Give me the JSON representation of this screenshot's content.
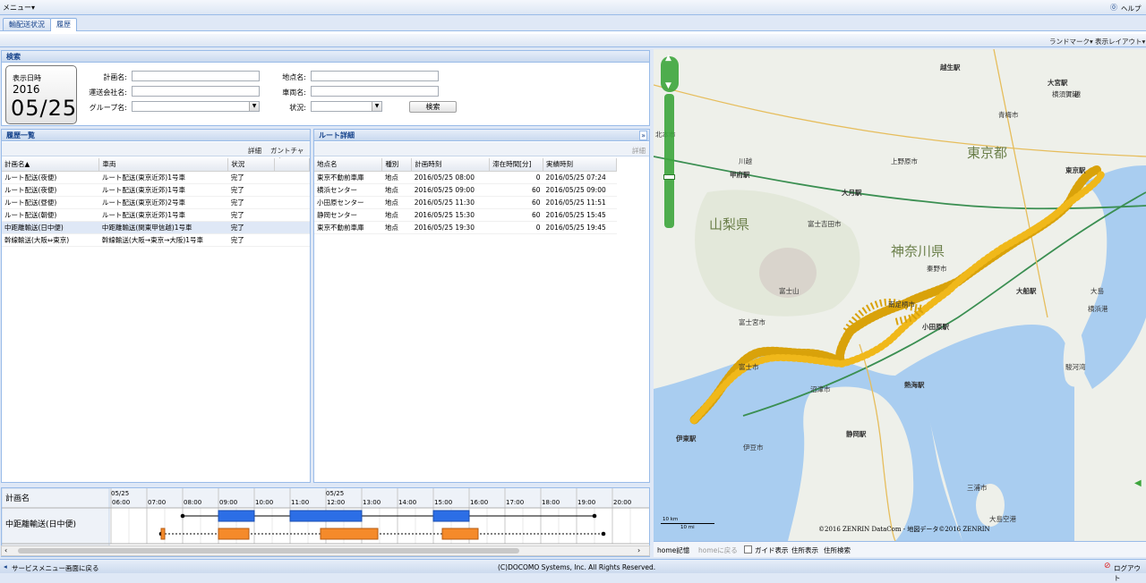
{
  "menu": {
    "label": "メニュー▾",
    "help": "ヘルプ"
  },
  "tabs": [
    {
      "label": "輸配送状況"
    },
    {
      "label": "履歴"
    }
  ],
  "toolbar": {
    "landmark": "ランドマーク▾",
    "layout": "表示レイアウト▾"
  },
  "search": {
    "title": "検索",
    "date_label": "表示日時",
    "year": "2016",
    "monthday": "05/25",
    "plan_name_label": "計画名:",
    "carrier_label": "運送会社名:",
    "group_label": "グループ名:",
    "place_label": "地点名:",
    "vehicle_label": "車両名:",
    "status_label": "状況:",
    "search_button": "検索"
  },
  "history": {
    "title": "履歴一覧",
    "detail_btn": "詳細",
    "gantt_btn": "ガントチャート",
    "columns": [
      "計画名▲",
      "車両",
      "状況"
    ],
    "rows": [
      [
        "ルート配送(夜便)",
        "ルート配送(東京近郊)1号車",
        "完了"
      ],
      [
        "ルート配送(夜便)",
        "ルート配送(東京近郊)1号車",
        "完了"
      ],
      [
        "ルート配送(昼便)",
        "ルート配送(東京近郊)2号車",
        "完了"
      ],
      [
        "ルート配送(朝便)",
        "ルート配送(東京近郊)1号車",
        "完了"
      ],
      [
        "中距離輸送(日中便)",
        "中距離輸送(関東甲信越)1号車",
        "完了"
      ],
      [
        "幹線輸送(大阪⇔東京)",
        "幹線輸送(大阪→東京→大阪)1号車",
        "完了"
      ]
    ],
    "selected_index": 4
  },
  "route": {
    "title": "ルート詳細",
    "detail_btn": "詳細",
    "columns": [
      "地点名",
      "種別",
      "計画時刻",
      "滞在時間[分]",
      "実績時刻"
    ],
    "rows": [
      [
        "東京不動前車庫",
        "地点",
        "2016/05/25 08:00",
        "0",
        "2016/05/25 07:24"
      ],
      [
        "横浜センター",
        "地点",
        "2016/05/25 09:00",
        "60",
        "2016/05/25 09:00"
      ],
      [
        "小田原センター",
        "地点",
        "2016/05/25 11:30",
        "60",
        "2016/05/25 11:51"
      ],
      [
        "静岡センター",
        "地点",
        "2016/05/25 15:30",
        "60",
        "2016/05/25 15:45"
      ],
      [
        "東京不動前車庫",
        "地点",
        "2016/05/25 19:30",
        "0",
        "2016/05/25 19:45"
      ]
    ]
  },
  "gantt": {
    "col_label": "計画名",
    "row_label": "中距離輸送(日中便)",
    "date1": "05/25",
    "date2": "05/25",
    "times": [
      "06:00",
      "07:00",
      "08:00",
      "09:00",
      "10:00",
      "11:00",
      "12:00",
      "13:00",
      "14:00",
      "15:00",
      "16:00",
      "17:00",
      "18:00",
      "19:00",
      "20:00"
    ],
    "plan_color": "#2c6ee6",
    "actual_color": "#f58a2a"
  },
  "map": {
    "copyright": "©2016 ZENRIN DataCom - 地図データ©2016 ZENRIN",
    "scale_km": "10 km",
    "scale_mi": "10 mi",
    "labels": [
      "越生駅",
      "大宮駅",
      "川越",
      "北本市",
      "青梅市",
      "東京都",
      "東京駅",
      "甲府駅",
      "大月駅",
      "山梨県",
      "神奈川県",
      "富士吉田市",
      "富士山",
      "秦野市",
      "大船駅",
      "南足柄市",
      "横浜港",
      "小田原駅",
      "富士宮市",
      "富士市",
      "沼津市",
      "熱海駅",
      "伊東駅",
      "静岡駅",
      "伊豆市",
      "駿河湾",
      "三浦市",
      "大島空港",
      "大島",
      "横須賀港",
      "川越",
      "上野原市",
      "昭島市"
    ],
    "footer_home": "home記憶",
    "footer_back": "homeに戻る",
    "footer_guide": "ガイド表示",
    "footer_addr": "住所表示",
    "footer_search": "住所検索"
  },
  "status": {
    "back": "サービスメニュー画面に戻る",
    "copyright": "(C)DOCOMO Systems, Inc. All Rights Reserved.",
    "logout": "ログアウト"
  }
}
